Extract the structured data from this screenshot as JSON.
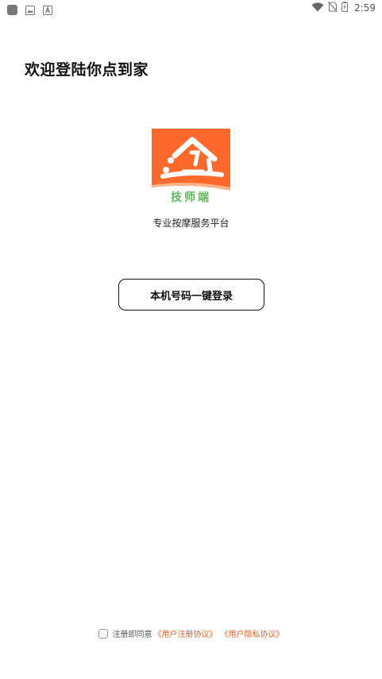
{
  "status_bar": {
    "time": "2:59",
    "left_icons": [
      "app-notification-icon",
      "image-notification-icon",
      "font-notification-icon"
    ],
    "right_icons": [
      "wifi-icon",
      "no-sim-icon",
      "battery-charging-icon"
    ]
  },
  "header": {
    "title": "欢迎登陆你点到家"
  },
  "logo": {
    "caption": "技师端",
    "brand_color": "#ff6a2c",
    "caption_color": "#5cb85c"
  },
  "platform_text": "专业按摩服务平台",
  "login": {
    "button_label": "本机号码一键登录"
  },
  "agreement": {
    "checked": false,
    "prefix": "注册即同意",
    "register_link": "《用户注册协议》",
    "privacy_link": "《用户隐私协议》",
    "link_color": "#e8662a"
  }
}
